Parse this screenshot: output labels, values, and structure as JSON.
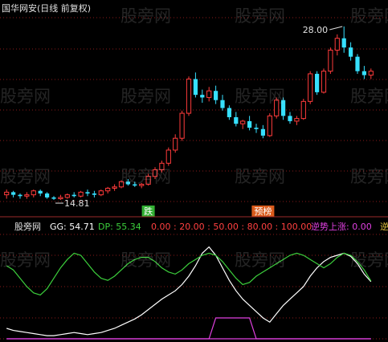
{
  "header": {
    "title": "国华网安(日线 前复权)"
  },
  "watermark": "股旁网",
  "colors": {
    "background": "#000000",
    "up": "#ff3b3b",
    "down": "#36e0ff",
    "gg": "#ffffff",
    "dp": "#3ccf3c",
    "signal": "#e040e0",
    "label": "#e0e0e0",
    "grid": "#8a1a1a"
  },
  "chart_data": [
    {
      "type": "candlestick",
      "title": "国华网安(日线 前复权)",
      "annotations": [
        {
          "text": "28.00",
          "kind": "high"
        },
        {
          "text": "14.81",
          "kind": "low"
        }
      ],
      "markers": [
        {
          "text": "跌",
          "color": "#3ccf3c"
        },
        {
          "text": "预榜",
          "color": "#ff6a20"
        }
      ],
      "ohlc": [
        [
          15.2,
          15.6,
          14.9,
          15.4
        ],
        [
          15.4,
          15.5,
          15.0,
          15.2
        ],
        [
          15.2,
          15.3,
          14.9,
          15.1
        ],
        [
          15.1,
          15.4,
          14.9,
          15.2
        ],
        [
          15.2,
          15.6,
          15.0,
          15.5
        ],
        [
          15.5,
          15.6,
          15.1,
          15.3
        ],
        [
          15.3,
          15.4,
          14.9,
          15.0
        ],
        [
          15.0,
          15.1,
          14.81,
          14.9
        ],
        [
          14.9,
          15.2,
          14.81,
          15.0
        ],
        [
          15.0,
          15.3,
          14.9,
          15.2
        ],
        [
          15.2,
          15.4,
          15.0,
          15.1
        ],
        [
          15.1,
          15.5,
          15.0,
          15.4
        ],
        [
          15.4,
          15.6,
          15.1,
          15.3
        ],
        [
          15.3,
          15.5,
          15.0,
          15.2
        ],
        [
          15.2,
          15.6,
          15.1,
          15.5
        ],
        [
          15.5,
          15.8,
          15.3,
          15.7
        ],
        [
          15.7,
          16.0,
          15.5,
          15.8
        ],
        [
          15.8,
          16.3,
          15.7,
          16.2
        ],
        [
          16.2,
          16.4,
          15.9,
          16.0
        ],
        [
          16.0,
          16.2,
          15.8,
          15.9
        ],
        [
          15.9,
          16.1,
          15.7,
          16.0
        ],
        [
          16.0,
          16.8,
          15.9,
          16.6
        ],
        [
          16.6,
          17.3,
          16.4,
          17.1
        ],
        [
          17.1,
          17.8,
          16.9,
          17.6
        ],
        [
          17.6,
          18.8,
          17.4,
          18.6
        ],
        [
          18.6,
          19.8,
          18.4,
          19.5
        ],
        [
          19.5,
          21.6,
          19.3,
          21.4
        ],
        [
          21.4,
          24.2,
          21.2,
          24.0
        ],
        [
          24.0,
          24.5,
          22.6,
          22.8
        ],
        [
          22.8,
          23.2,
          22.2,
          22.6
        ],
        [
          22.6,
          23.4,
          22.3,
          23.1
        ],
        [
          23.1,
          23.5,
          22.1,
          22.4
        ],
        [
          22.4,
          22.8,
          21.6,
          21.8
        ],
        [
          21.8,
          22.0,
          20.9,
          21.1
        ],
        [
          21.1,
          21.5,
          20.4,
          20.6
        ],
        [
          20.6,
          20.9,
          20.2,
          20.8
        ],
        [
          20.8,
          21.2,
          20.1,
          20.3
        ],
        [
          20.3,
          20.6,
          19.9,
          20.2
        ],
        [
          20.2,
          20.5,
          19.5,
          19.7
        ],
        [
          19.7,
          21.4,
          19.6,
          21.2
        ],
        [
          21.2,
          22.6,
          21.0,
          22.4
        ],
        [
          22.4,
          22.6,
          20.9,
          21.2
        ],
        [
          21.2,
          21.5,
          20.6,
          20.8
        ],
        [
          20.8,
          21.2,
          20.5,
          21.0
        ],
        [
          21.0,
          22.5,
          20.9,
          22.3
        ],
        [
          22.3,
          24.6,
          22.1,
          24.4
        ],
        [
          24.4,
          24.6,
          22.8,
          23.0
        ],
        [
          23.0,
          24.8,
          22.9,
          24.6
        ],
        [
          24.6,
          26.4,
          24.4,
          26.2
        ],
        [
          26.2,
          27.4,
          25.8,
          27.1
        ],
        [
          27.1,
          28.0,
          26.0,
          26.4
        ],
        [
          26.4,
          26.8,
          25.4,
          25.7
        ],
        [
          25.7,
          25.9,
          24.4,
          24.6
        ],
        [
          24.6,
          25.0,
          24.0,
          24.3
        ],
        [
          24.3,
          24.8,
          24.0,
          24.6
        ]
      ]
    },
    {
      "type": "line",
      "labels": {
        "name": "股旁网",
        "gg": "GG: 54.71",
        "dp": "DP: 55.34",
        "levels": "0.00 : 20.00 : 50.00 : 80.00 : 100.00",
        "rev": "逆势上涨: 0.00",
        "tail": "逆"
      },
      "ylim": [
        0,
        100
      ],
      "levels": [
        0,
        20,
        50,
        80,
        100
      ],
      "series": [
        {
          "name": "GG",
          "values": [
            10,
            8,
            7,
            6,
            5,
            4,
            3,
            3,
            4,
            5,
            6,
            5,
            4,
            5,
            6,
            8,
            10,
            13,
            16,
            19,
            23,
            28,
            33,
            38,
            42,
            46,
            52,
            60,
            70,
            82,
            88,
            80,
            68,
            56,
            46,
            38,
            32,
            26,
            20,
            16,
            24,
            32,
            38,
            44,
            50,
            60,
            68,
            74,
            78,
            80,
            82,
            79,
            72,
            62,
            54.71
          ]
        },
        {
          "name": "DP",
          "values": [
            70,
            66,
            58,
            50,
            44,
            42,
            48,
            58,
            68,
            76,
            82,
            80,
            72,
            64,
            58,
            56,
            60,
            66,
            72,
            76,
            78,
            78,
            74,
            68,
            64,
            62,
            66,
            72,
            76,
            80,
            82,
            80,
            74,
            66,
            58,
            52,
            54,
            60,
            64,
            68,
            72,
            76,
            80,
            82,
            80,
            76,
            72,
            68,
            72,
            78,
            82,
            80,
            74,
            66,
            55.34
          ]
        },
        {
          "name": "逆势上涨",
          "values": [
            0,
            0,
            0,
            0,
            0,
            0,
            0,
            0,
            0,
            0,
            0,
            0,
            0,
            0,
            0,
            0,
            0,
            0,
            0,
            0,
            0,
            0,
            0,
            0,
            0,
            0,
            0,
            0,
            0,
            0,
            0,
            0,
            0,
            0,
            0,
            0,
            0,
            0,
            0,
            0,
            0,
            0,
            0,
            0,
            0,
            0,
            0,
            0,
            0,
            0,
            0,
            0,
            0,
            0,
            0
          ]
        },
        {
          "name": "signal",
          "values": [
            0,
            0,
            0,
            0,
            0,
            0,
            0,
            0,
            0,
            0,
            0,
            0,
            0,
            0,
            0,
            0,
            0,
            0,
            0,
            0,
            0,
            0,
            0,
            0,
            0,
            0,
            0,
            0,
            0,
            0,
            0,
            20,
            20,
            20,
            20,
            20,
            20,
            0,
            0,
            0,
            0,
            0,
            0,
            0,
            0,
            0,
            0,
            0,
            0,
            0,
            0,
            0,
            0,
            0,
            0
          ]
        }
      ]
    }
  ]
}
